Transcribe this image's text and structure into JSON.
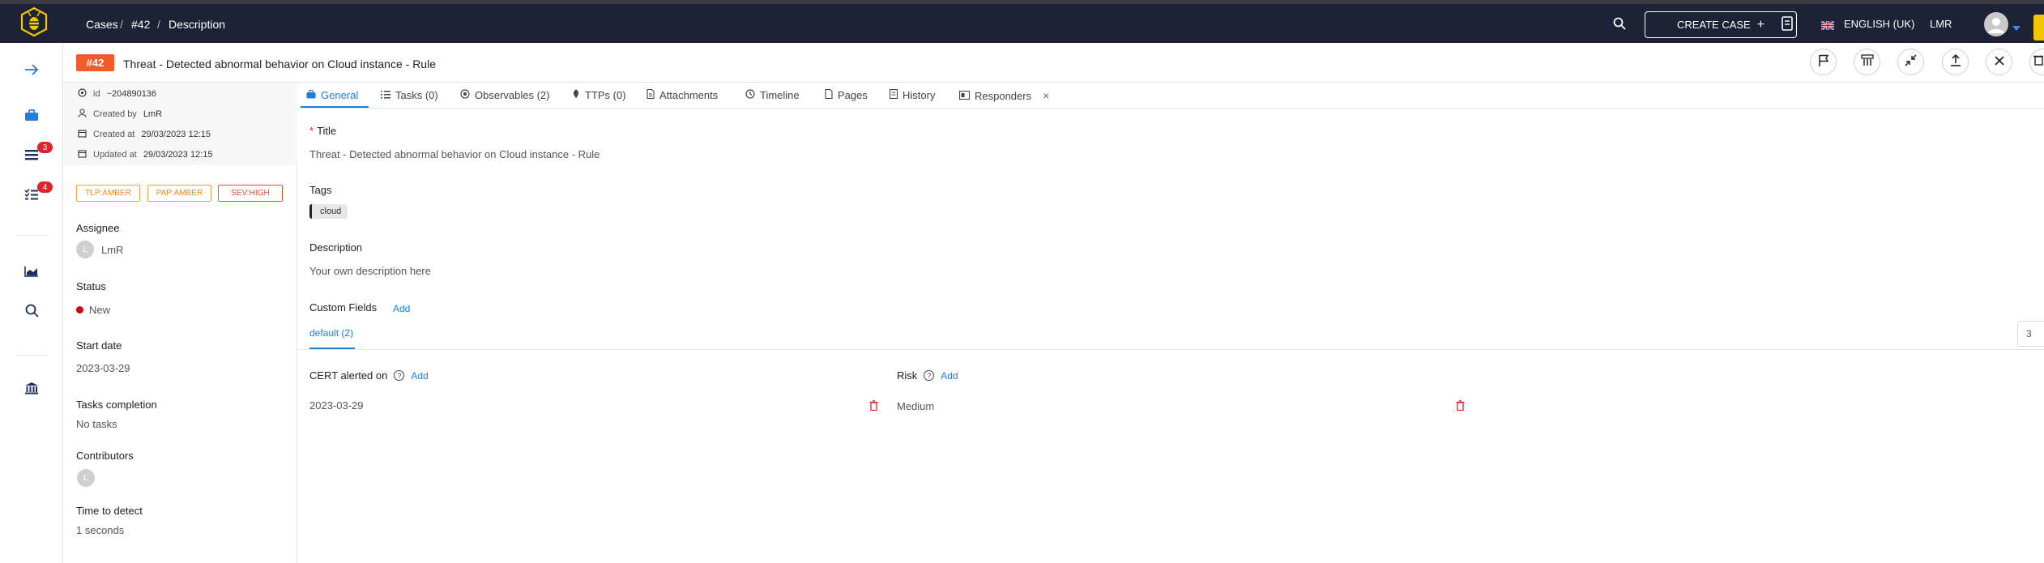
{
  "breadcrumb": {
    "cases": "Cases",
    "sep1": "/",
    "case": "#42",
    "sep2": "/",
    "page": "Description"
  },
  "topbar": {
    "create_case": "CREATE CASE",
    "language": "ENGLISH (UK)",
    "user": "LMR",
    "icons": [
      "search-icon",
      "plus-icon",
      "book-icon",
      "uk-flag-icon",
      "avatar-icon",
      "chevron-down-icon"
    ]
  },
  "rail": {
    "badges": {
      "alerts": "3",
      "tasks": "4"
    },
    "icons": [
      "arrow-right-icon",
      "cases-icon",
      "alerts-icon",
      "tasks-icon",
      "dashboard-icon",
      "search-icon",
      "organisation-icon"
    ]
  },
  "case": {
    "number": "#42",
    "title": "Threat - Detected abnormal behavior on Cloud instance - Rule"
  },
  "meta": {
    "id_label": "id",
    "id_value": "~204890136",
    "created_by_label": "Created by",
    "created_by_value": "LmR",
    "created_at_label": "Created at",
    "created_at_value": "29/03/2023 12:15",
    "updated_at_label": "Updated at",
    "updated_at_value": "29/03/2023 12:15"
  },
  "pills": {
    "tlp": "TLP:AMBER",
    "pap": "PAP:AMBER",
    "sev": "SEV:HIGH"
  },
  "details": {
    "assignee_label": "Assignee",
    "assignee_initial": "L",
    "assignee_value": "LmR",
    "status_label": "Status",
    "status_value": "New",
    "status_color": "#d0021b",
    "start_date_label": "Start date",
    "start_date_value": "2023-03-29",
    "tasks_completion_label": "Tasks completion",
    "tasks_completion_value": "No tasks",
    "contributors_label": "Contributors",
    "contributor_initial": "L",
    "ttd_label": "Time to detect",
    "ttd_value": "1 seconds"
  },
  "tabs": [
    {
      "label": "General"
    },
    {
      "label": "Tasks (0)"
    },
    {
      "label": "Observables (2)"
    },
    {
      "label": "TTPs (0)"
    },
    {
      "label": "Attachments"
    },
    {
      "label": "Timeline"
    },
    {
      "label": "Pages"
    },
    {
      "label": "History"
    },
    {
      "label": "Responders"
    }
  ],
  "general": {
    "title_required": "*",
    "title_label": "Title",
    "title_value": "Threat - Detected abnormal behavior on Cloud instance - Rule",
    "tags_label": "Tags",
    "tag": "cloud",
    "description_label": "Description",
    "description_value": "Your own description here",
    "custom_fields_label": "Custom Fields",
    "add_label": "Add",
    "cf_group_tab": "default (2)",
    "page_size": "3",
    "fields": [
      {
        "label": "CERT alerted on",
        "add": "Add",
        "value": "2023-03-29"
      },
      {
        "label": "Risk",
        "add": "Add",
        "value": "Medium"
      }
    ]
  },
  "colors": {
    "topbar": "#1e2236",
    "accent": "#1f7ddb",
    "case_badge": "#f25a28",
    "amber": "#f08a24",
    "danger": "#e0242c"
  }
}
